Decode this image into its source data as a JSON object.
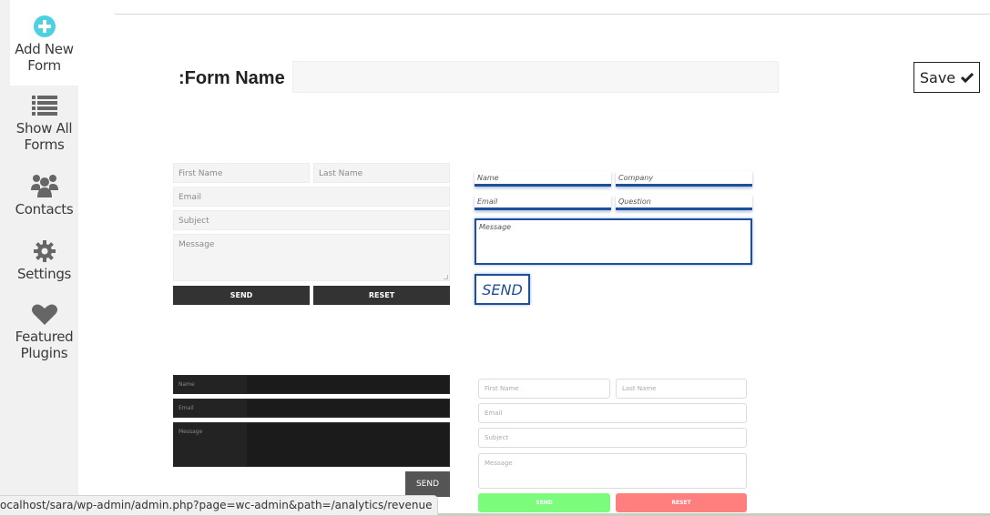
{
  "sidebar": {
    "items": [
      {
        "label": "Add New Form",
        "icon": "plus-circle-icon",
        "active": true
      },
      {
        "label": "Show All Forms",
        "icon": "list-icon"
      },
      {
        "label": "Contacts",
        "icon": "users-icon"
      },
      {
        "label": "Settings",
        "icon": "gear-icon"
      },
      {
        "label": "Featured Plugins",
        "icon": "heart-icon"
      }
    ]
  },
  "colors": {
    "accent": "#4dd0e1",
    "sidebar_bg": "#f1f1f1",
    "icon_gray": "#666666",
    "template2_blue": "#1f4f99",
    "template4_send": "#7cfc7c",
    "template4_reset": "#ff7f7f"
  },
  "header": {
    "form_name_label": ":Form Name",
    "form_name_value": "",
    "save_label": "Save",
    "save_icon": "check-icon"
  },
  "templates": [
    {
      "name": "light-gray",
      "fields": {
        "first_name": "First Name",
        "last_name": "Last Name",
        "email": "Email",
        "subject": "Subject",
        "message": "Message"
      },
      "buttons": {
        "send": "SEND",
        "reset": "RESET"
      }
    },
    {
      "name": "blue-underline",
      "fields": {
        "name": "Name",
        "company": "Company",
        "email": "Email",
        "question": "Question",
        "message": "Message"
      },
      "buttons": {
        "send": "SEND"
      }
    },
    {
      "name": "dark",
      "fields": {
        "name": "Name",
        "email": "Email",
        "message": "Message"
      },
      "buttons": {
        "send": "SEND"
      }
    },
    {
      "name": "rounded-color",
      "fields": {
        "first_name": "First Name",
        "last_name": "Last Name",
        "email": "Email",
        "subject": "Subject",
        "message": "Message"
      },
      "buttons": {
        "send": "SEND",
        "reset": "RESET"
      }
    }
  ],
  "status_bar": {
    "url": "ocalhost/sara/wp-admin/admin.php?page=wc-admin&path=/analytics/revenue"
  }
}
